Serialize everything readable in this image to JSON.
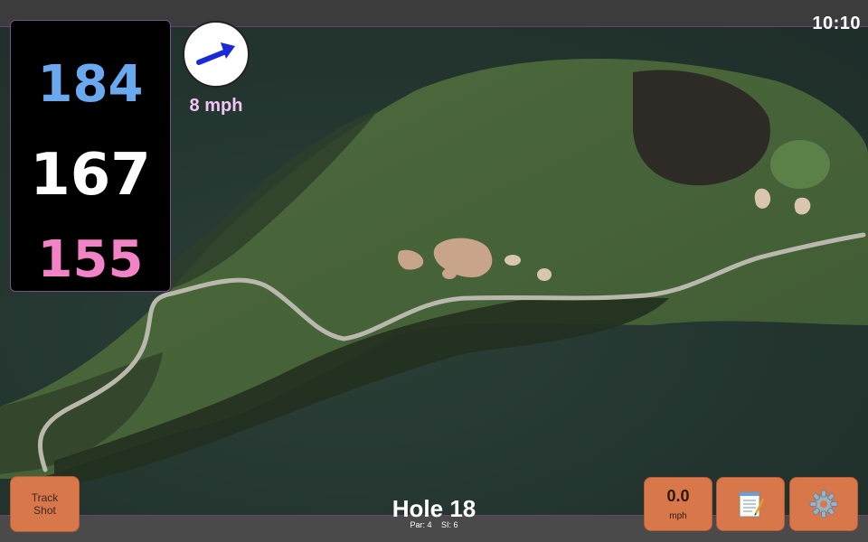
{
  "status_bar": {
    "clock": "10:10"
  },
  "distances": {
    "back": "184",
    "middle": "167",
    "front": "155"
  },
  "wind": {
    "speed_label": "8 mph",
    "direction_icon": "wind-arrow-icon"
  },
  "buttons": {
    "track_shot": {
      "line1": "Track",
      "line2": "Shot"
    },
    "speed": {
      "value": "0.0",
      "unit": "mph"
    },
    "notes_icon": "notepad-icon",
    "settings_icon": "gear-icon"
  },
  "hole": {
    "title": "Hole 18",
    "par": "Par: 4",
    "si": "SI: 6"
  },
  "colors": {
    "back_distance": "#6aa9ee",
    "middle_distance": "#ffffff",
    "front_distance": "#f283c6",
    "button": "#d8774a",
    "wind_label": "#f2c4f2"
  }
}
